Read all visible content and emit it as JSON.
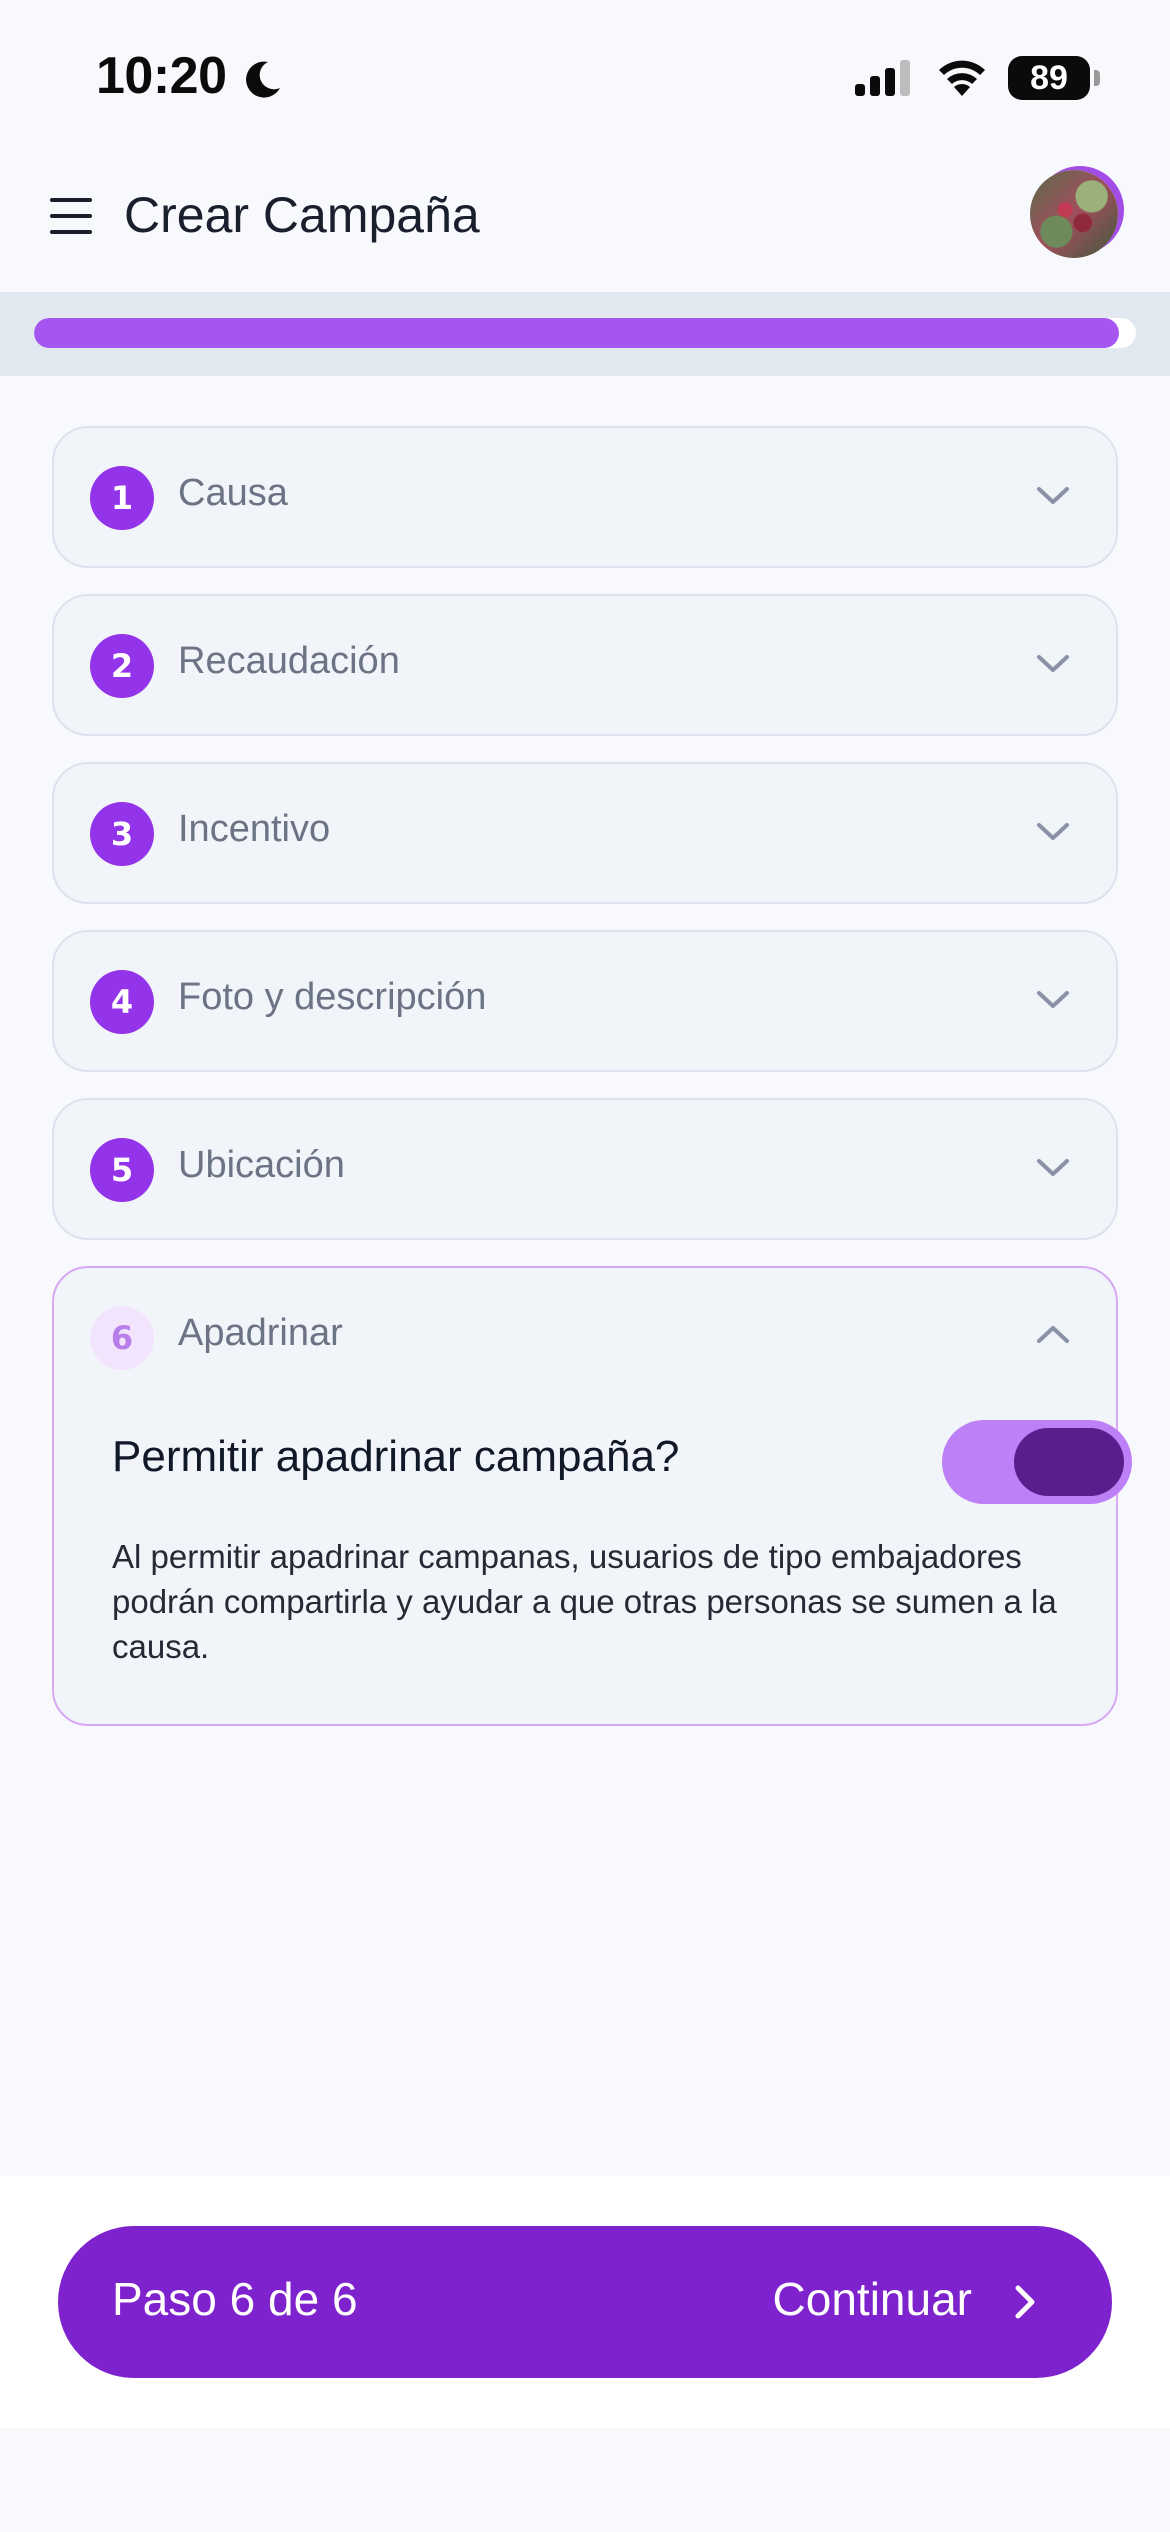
{
  "status_bar": {
    "time": "10:20",
    "battery": "89",
    "icons": [
      "moon-icon",
      "signal-icon",
      "wifi-icon",
      "battery-icon"
    ]
  },
  "header": {
    "title": "Crear Campaña",
    "menu_icon": "hamburger-menu-icon",
    "avatar": "user-avatar"
  },
  "progress": {
    "fraction": 0.985,
    "color": "#a556f0"
  },
  "steps": [
    {
      "number": "1",
      "label": "Causa",
      "expanded": false
    },
    {
      "number": "2",
      "label": "Recaudación",
      "expanded": false
    },
    {
      "number": "3",
      "label": "Incentivo",
      "expanded": false
    },
    {
      "number": "4",
      "label": "Foto y descripción",
      "expanded": false
    },
    {
      "number": "5",
      "label": "Ubicación",
      "expanded": false
    },
    {
      "number": "6",
      "label": "Apadrinar",
      "expanded": true
    }
  ],
  "apadrinar": {
    "question": "Permitir apadrinar campaña?",
    "toggle_on": true,
    "description": "Al permitir apadrinar campanas, usuarios de tipo embajadores podrán compartirla y ayudar a que otras personas se sumen a la causa."
  },
  "footer": {
    "step_counter": "Paso 6 de 6",
    "continue_label": "Continuar",
    "accent": "#7e22ce"
  }
}
